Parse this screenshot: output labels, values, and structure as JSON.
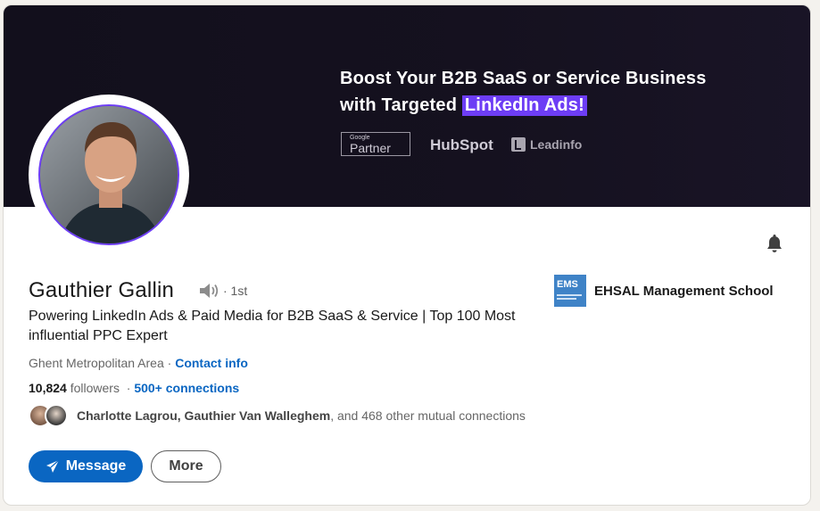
{
  "banner": {
    "line1": "Boost Your B2B SaaS or Service Business",
    "line2_prefix": "with Targeted ",
    "line2_highlight": "LinkedIn Ads!",
    "logos": {
      "google_small": "Google",
      "google_big": "Partner",
      "hubspot": "HubSpot",
      "leadinfo": "Leadinfo"
    }
  },
  "profile": {
    "name": "Gauthier Gallin",
    "degree": "· 1st",
    "headline": "Powering LinkedIn Ads & Paid Media for B2B SaaS & Service | Top 100 Most influential PPC Expert",
    "location": "Ghent Metropolitan Area",
    "location_sep": " · ",
    "contact_info": "Contact info",
    "followers_count": "10,824",
    "followers_label": " followers",
    "stats_sep": "  · ",
    "connections": "500+ connections",
    "mutual_names": "Charlotte Lagrou, Gauthier Van Walleghem",
    "mutual_rest": ", and 468 other mutual connections"
  },
  "school": {
    "logo_text": "EMS",
    "name": "EHSAL Management School"
  },
  "actions": {
    "message": "Message",
    "more": "More"
  },
  "colors": {
    "primary": "#0a66c2",
    "banner_bg": "#15111f",
    "highlight": "#6d3df5"
  }
}
